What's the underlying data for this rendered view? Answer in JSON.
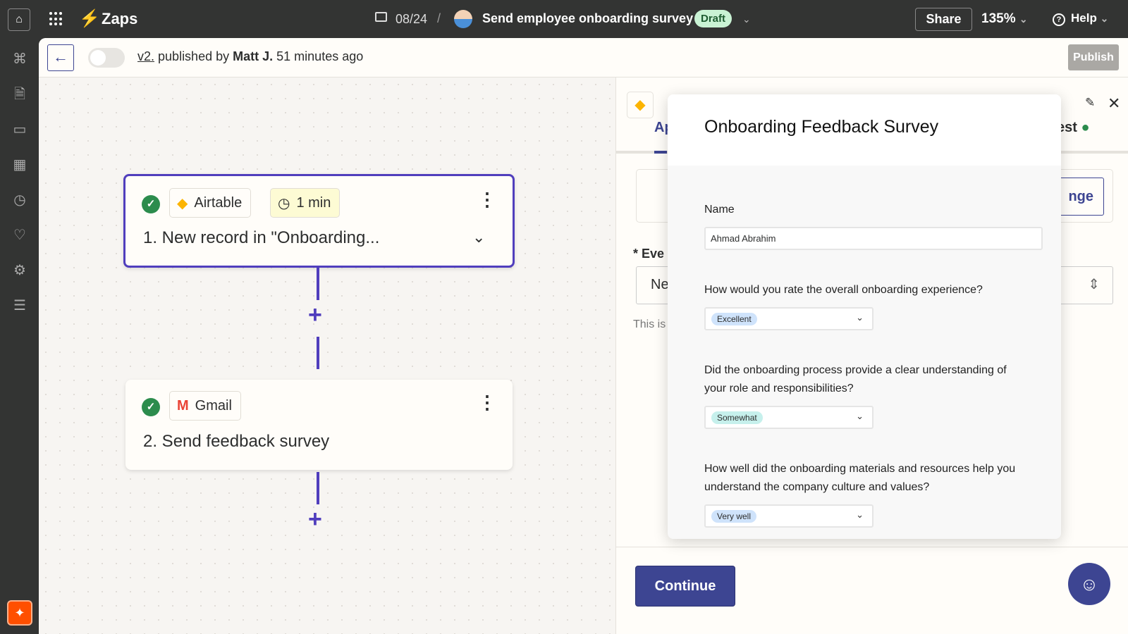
{
  "topbar": {
    "app_name": "Zaps",
    "folder": "08/24",
    "separator": "/",
    "zap_name": "Send employee onboarding survey",
    "status_badge": "Draft",
    "share_label": "Share",
    "zoom_level": "135%",
    "help_label": "Help"
  },
  "subbar": {
    "version": "v2.",
    "published_by": "published by",
    "author": "Matt J.",
    "time_ago": "51 minutes ago",
    "publish_label": "Publish",
    "toggle_on": false
  },
  "steps": [
    {
      "app": "Airtable",
      "badge": "1 min",
      "title": "1. New record in \"Onboarding...",
      "status": "complete"
    },
    {
      "app": "Gmail",
      "title": "2. Send feedback survey",
      "status": "complete"
    }
  ],
  "panel": {
    "tab_partial_left": "Ap",
    "tab_partial_right": "est",
    "change_partial": "nge",
    "event_partial": "* Eve",
    "event_value_partial": "Ne",
    "help_partial": "This is",
    "continue_label": "Continue"
  },
  "survey": {
    "title": "Onboarding Feedback Survey",
    "name_label": "Name",
    "name_value": "Ahmad Abrahim",
    "questions": [
      {
        "text": "How would you rate the overall onboarding experience?",
        "answer": "Excellent",
        "color": "#cfe3fb"
      },
      {
        "text": "Did the onboarding process provide a clear understanding of your role and responsibilities?",
        "answer": "Somewhat",
        "color": "#c6f0ec"
      },
      {
        "text": "How well did the onboarding materials and resources help you understand the company culture and values?",
        "answer": "Very well",
        "color": "#cfe3fb"
      }
    ]
  },
  "colors": {
    "accent": "#503ebd",
    "brand": "#ff4f00",
    "primary_button": "#3d4592",
    "success": "#2c8c4d"
  }
}
